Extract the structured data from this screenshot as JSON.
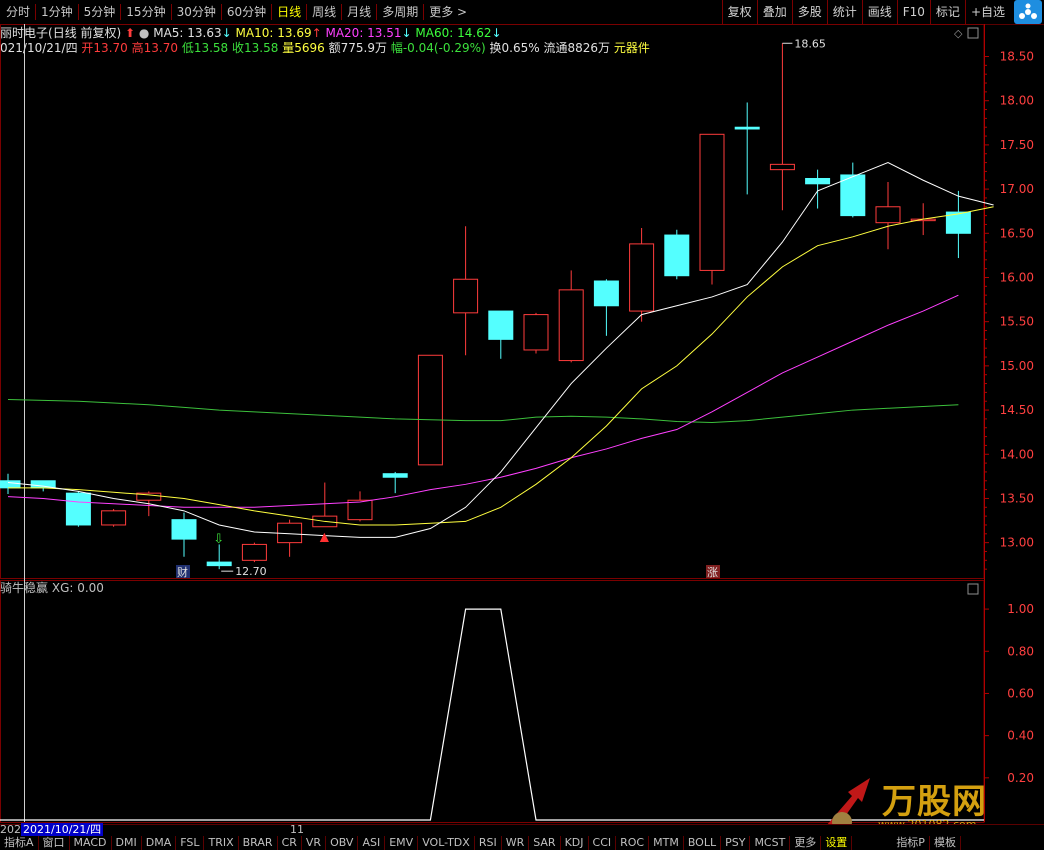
{
  "toolbar": {
    "periods": [
      "分时",
      "1分钟",
      "5分钟",
      "15分钟",
      "30分钟",
      "60分钟",
      "日线",
      "周线",
      "月线",
      "多周期",
      "更多 >"
    ],
    "active_period": "日线",
    "right_buttons": [
      "复权",
      "叠加",
      "多股",
      "统计",
      "画线",
      "F10",
      "标记",
      "+自选"
    ]
  },
  "header": {
    "stock_name": "丽时电子",
    "adjust_label": "(日线 前复权)",
    "ma5": "MA5: 13.63",
    "ma5_arrow": "↓",
    "ma10": "MA10: 13.69",
    "ma10_arrow": "↑",
    "ma20": "MA20: 13.51",
    "ma20_arrow": "↓",
    "ma60": "MA60: 14.62",
    "ma60_arrow": "↓",
    "date": "021/10/21/四",
    "open_label": "开",
    "open": "13.70",
    "high_label": "高",
    "high": "13.70",
    "low_label": "低",
    "low": "13.58",
    "close_label": "收",
    "close": "13.58",
    "vol_label": "量",
    "vol": "5696",
    "amt_label": "额",
    "amt": "775.9万",
    "chg_label": "幅",
    "chg": "-0.04(-0.29%)",
    "turnover": "换0.65%",
    "float": "流通8826万",
    "sector": "元器件"
  },
  "axis": {
    "price_ticks": [
      "18.50",
      "18.00",
      "17.50",
      "17.00",
      "16.50",
      "16.00",
      "15.50",
      "15.00",
      "14.50",
      "14.00",
      "13.50",
      "13.00"
    ],
    "sub_ticks": [
      "1.00",
      "0.80",
      "0.60",
      "0.40",
      "0.20"
    ]
  },
  "annotations": {
    "high_label": "18.65",
    "low_label": "12.70",
    "badge_cai": "财",
    "badge_zhang": "涨"
  },
  "sub": {
    "title": "骑牛稳赢",
    "xg": "XG: 0.00"
  },
  "datebar": {
    "year_prefix": "202",
    "current_date": "2021/10/21/四",
    "month_mark": "11"
  },
  "tabs": [
    "指标A",
    "窗口",
    "MACD",
    "DMI",
    "DMA",
    "FSL",
    "TRIX",
    "BRAR",
    "CR",
    "VR",
    "OBV",
    "ASI",
    "EMV",
    "VOL-TDX",
    "RSI",
    "WR",
    "SAR",
    "KDJ",
    "CCI",
    "ROC",
    "MTM",
    "BOLL",
    "PSY",
    "MCST",
    "更多",
    "设置"
  ],
  "tabs_selected": "设置",
  "tabs_right": [
    "指标P",
    "模板"
  ],
  "watermark": {
    "title": "万股网",
    "url": "www.201082.com"
  },
  "colors": {
    "up": "#ff3c3c",
    "down": "#54ffff",
    "ma5": "#ffffff",
    "ma10": "#ffff40",
    "ma20": "#ff40ff",
    "ma60": "#3cc03c",
    "grid": "#7a0000"
  },
  "chart_data": {
    "type": "candlestick",
    "price_ylim": [
      12.6,
      18.8
    ],
    "candles": [
      {
        "o": 13.7,
        "c": 13.62,
        "h": 13.78,
        "l": 13.55
      },
      {
        "o": 13.7,
        "c": 13.62,
        "h": 13.7,
        "l": 13.58
      },
      {
        "o": 13.56,
        "c": 13.2,
        "h": 13.58,
        "l": 13.18
      },
      {
        "o": 13.2,
        "c": 13.36,
        "h": 13.38,
        "l": 13.18
      },
      {
        "o": 13.48,
        "c": 13.56,
        "h": 13.58,
        "l": 13.3
      },
      {
        "o": 13.26,
        "c": 13.04,
        "h": 13.34,
        "l": 12.84
      },
      {
        "o": 12.78,
        "c": 12.74,
        "h": 12.98,
        "l": 12.7
      },
      {
        "o": 12.8,
        "c": 12.98,
        "h": 13.0,
        "l": 12.78
      },
      {
        "o": 13.0,
        "c": 13.22,
        "h": 13.26,
        "l": 12.84
      },
      {
        "o": 13.18,
        "c": 13.3,
        "h": 13.68,
        "l": 13.18
      },
      {
        "o": 13.26,
        "c": 13.48,
        "h": 13.58,
        "l": 13.24
      },
      {
        "o": 13.78,
        "c": 13.74,
        "h": 13.8,
        "l": 13.56
      },
      {
        "o": 13.88,
        "c": 15.12,
        "h": 15.12,
        "l": 13.88
      },
      {
        "o": 15.6,
        "c": 15.98,
        "h": 16.58,
        "l": 15.12
      },
      {
        "o": 15.62,
        "c": 15.3,
        "h": 15.62,
        "l": 15.08
      },
      {
        "o": 15.18,
        "c": 15.58,
        "h": 15.6,
        "l": 15.14
      },
      {
        "o": 15.06,
        "c": 15.86,
        "h": 16.08,
        "l": 15.04
      },
      {
        "o": 15.96,
        "c": 15.68,
        "h": 15.98,
        "l": 15.34
      },
      {
        "o": 15.62,
        "c": 16.38,
        "h": 16.56,
        "l": 15.5
      },
      {
        "o": 16.48,
        "c": 16.02,
        "h": 16.54,
        "l": 15.98
      },
      {
        "o": 16.08,
        "c": 17.62,
        "h": 17.62,
        "l": 15.92
      },
      {
        "o": 17.7,
        "c": 17.68,
        "h": 17.98,
        "l": 16.94
      },
      {
        "o": 17.22,
        "c": 17.28,
        "h": 18.65,
        "l": 16.76
      },
      {
        "o": 17.12,
        "c": 17.06,
        "h": 17.22,
        "l": 16.78
      },
      {
        "o": 17.16,
        "c": 16.7,
        "h": 17.3,
        "l": 16.68
      },
      {
        "o": 16.62,
        "c": 16.8,
        "h": 17.08,
        "l": 16.32
      },
      {
        "o": 16.66,
        "c": 16.66,
        "h": 16.84,
        "l": 16.48
      },
      {
        "o": 16.74,
        "c": 16.5,
        "h": 16.98,
        "l": 16.22
      }
    ],
    "ma5": [
      13.68,
      13.64,
      13.58,
      13.5,
      13.44,
      13.36,
      13.2,
      13.12,
      13.1,
      13.08,
      13.06,
      13.06,
      13.16,
      13.4,
      13.8,
      14.3,
      14.8,
      15.2,
      15.58,
      15.68,
      15.78,
      15.92,
      16.4,
      16.98,
      17.14,
      17.3,
      17.1,
      16.92,
      16.82
    ],
    "ma10": [
      13.62,
      13.62,
      13.6,
      13.57,
      13.54,
      13.5,
      13.43,
      13.36,
      13.3,
      13.24,
      13.2,
      13.2,
      13.22,
      13.24,
      13.4,
      13.66,
      13.96,
      14.32,
      14.74,
      15.0,
      15.36,
      15.78,
      16.12,
      16.36,
      16.46,
      16.58,
      16.66,
      16.72,
      16.8
    ],
    "ma20": [
      13.52,
      13.5,
      13.46,
      13.44,
      13.42,
      13.4,
      13.4,
      13.4,
      13.42,
      13.44,
      13.46,
      13.52,
      13.6,
      13.66,
      13.74,
      13.84,
      13.96,
      14.06,
      14.18,
      14.28,
      14.48,
      14.7,
      14.92,
      15.1,
      15.28,
      15.46,
      15.62,
      15.8
    ],
    "ma60": [
      14.62,
      14.61,
      14.6,
      14.58,
      14.56,
      14.53,
      14.5,
      14.48,
      14.46,
      14.44,
      14.42,
      14.4,
      14.39,
      14.38,
      14.38,
      14.42,
      14.43,
      14.42,
      14.4,
      14.37,
      14.36,
      14.38,
      14.42,
      14.46,
      14.5,
      14.52,
      14.54,
      14.56
    ],
    "xg": [
      0,
      0,
      0,
      0,
      0,
      0,
      0,
      0,
      0,
      0,
      0,
      0,
      0,
      1,
      1,
      0,
      0,
      0,
      0,
      0,
      0,
      0,
      0,
      0,
      0,
      0,
      0,
      0
    ],
    "sub_ylim": [
      0,
      1.1
    ]
  }
}
